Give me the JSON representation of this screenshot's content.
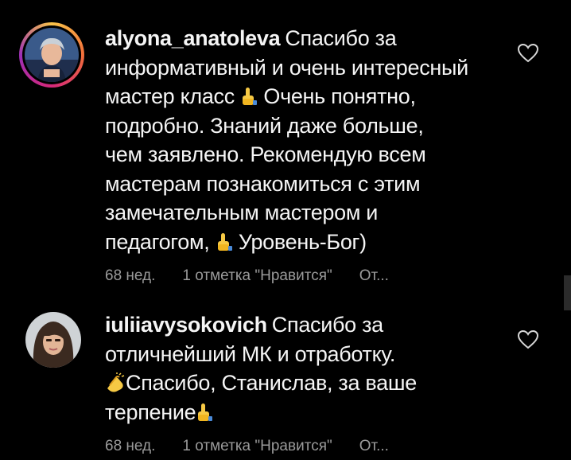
{
  "comments": [
    {
      "username": "alyona_anatoleva",
      "line1": "Спасибо за",
      "line2": "информативный и очень интересный",
      "line3a": "мастер класс",
      "line3b": " Очень понятно,",
      "line4": "подробно. Знаний даже больше,",
      "line5": "чем заявлено. Рекомендую всем",
      "line6": "мастерам познакомиться с этим",
      "line7": "замечательным мастером и",
      "line8a": "педагогом, ",
      "line8b": "Уровень-Бог)",
      "time": "68 нед.",
      "likes": "1 отметка \"Нравится\"",
      "reply": "От..."
    },
    {
      "username": "iuliiavysokovich",
      "line1": "Спасибо за",
      "line2": "отличнейший МК и отработку.",
      "line3": "Спасибо, Станислав, за ваше",
      "line4": "терпение",
      "time": "68 нед.",
      "likes": "1 отметка \"Нравится\"",
      "reply": "От..."
    }
  ],
  "icons": {
    "like": "heart-outline-icon",
    "emoji_thumb": "thumbs-up-emoji",
    "emoji_clap": "clapping-hands-emoji"
  }
}
